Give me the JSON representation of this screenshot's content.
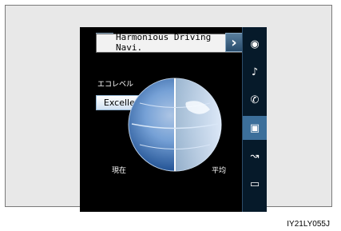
{
  "header": {
    "title": "Harmonious Driving Navi.",
    "left_icon": "chevron-left-icon",
    "right_icon": "chevron-right-icon"
  },
  "eco": {
    "label": "エコレベル",
    "status": "Excellent",
    "left_label": "現在",
    "right_label": "平均"
  },
  "sidebar": {
    "items": [
      {
        "icon": "globe-icon",
        "label": "◉"
      },
      {
        "icon": "music-icon",
        "label": "♪"
      },
      {
        "icon": "phone-icon",
        "label": "✆"
      },
      {
        "icon": "image-icon",
        "label": "▣"
      },
      {
        "icon": "route-icon",
        "label": "↝"
      },
      {
        "icon": "display-icon",
        "label": "▭"
      }
    ]
  },
  "footer": {
    "caption": "IY21LY055J"
  }
}
